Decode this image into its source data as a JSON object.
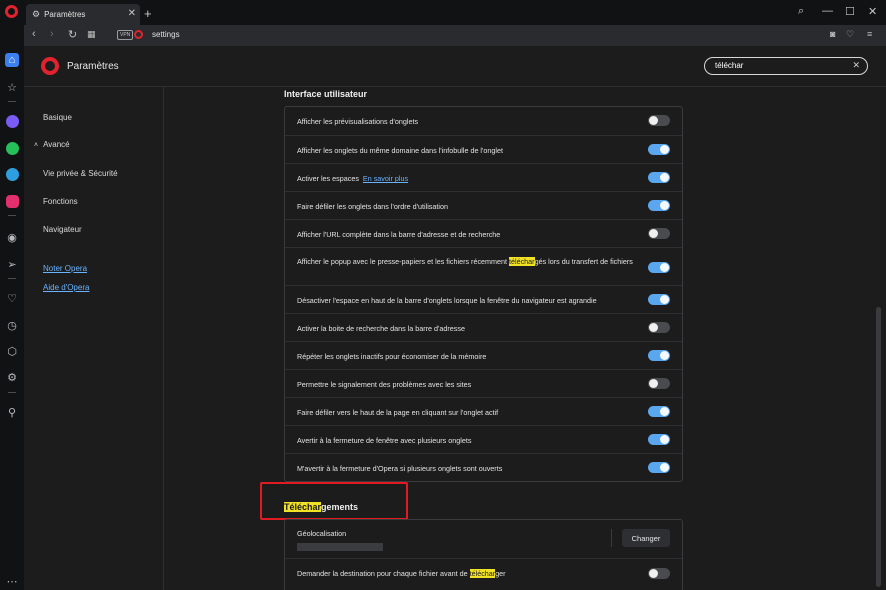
{
  "browser": {
    "tab_title": "Paramètres",
    "address": "settings",
    "vpn_label": "VPN"
  },
  "header": {
    "title": "Paramètres",
    "search_value": "téléchar"
  },
  "sidenav": {
    "basic": "Basique",
    "advanced": "Avancé",
    "privacy": "Vie privée & Sécurité",
    "features": "Fonctions",
    "browser": "Navigateur",
    "rate": "Noter Opera",
    "help": "Aide d'Opera"
  },
  "ui_section": {
    "title": "Interface utilisateur",
    "rows": [
      {
        "label": "Afficher les prévisualisations d'onglets",
        "on": false
      },
      {
        "label": "Afficher les onglets du même domaine dans l'infobulle de l'onglet",
        "on": true
      },
      {
        "label": "Activer les espaces",
        "link": "En savoir plus",
        "on": true
      },
      {
        "label": "Faire défiler les onglets dans l'ordre d'utilisation",
        "on": true
      },
      {
        "label": "Afficher l'URL complète dans la barre d'adresse et de recherche",
        "on": false
      },
      {
        "label_pre": "Afficher le popup avec le presse-papiers et les fichiers récemment ",
        "label_hl": "téléchar",
        "label_post": "gés lors du transfert de fichiers",
        "on": true
      },
      {
        "label": "Désactiver l'espace en haut de la barre d'onglets lorsque la fenêtre du navigateur est agrandie",
        "on": true
      },
      {
        "label": "Activer la boite de recherche dans la barre d'adresse",
        "on": false
      },
      {
        "label": "Répéter les onglets inactifs pour économiser de la mémoire",
        "on": true
      },
      {
        "label": "Permettre le signalement des problèmes avec les sites",
        "on": false
      },
      {
        "label": "Faire défiler vers le haut de la page en cliquant sur l'onglet actif",
        "on": true
      },
      {
        "label": "Avertir à la fermeture de fenêtre avec plusieurs onglets",
        "on": true
      },
      {
        "label": "M'avertir à la fermeture d'Opera si plusieurs onglets sont ouverts",
        "on": true
      }
    ]
  },
  "downloads_section": {
    "title_hl": "Téléchar",
    "title_post": "gements",
    "location_label": "Géolocalisation",
    "change_button": "Changer",
    "ask_pre": "Demander la destination pour chaque fichier avant de ",
    "ask_hl": "téléchar",
    "ask_post": "ger",
    "ask_on": false
  },
  "colors": {
    "accent": "#5aa7ef",
    "highlight": "#f2e225",
    "opera_red": "#e0232e"
  }
}
